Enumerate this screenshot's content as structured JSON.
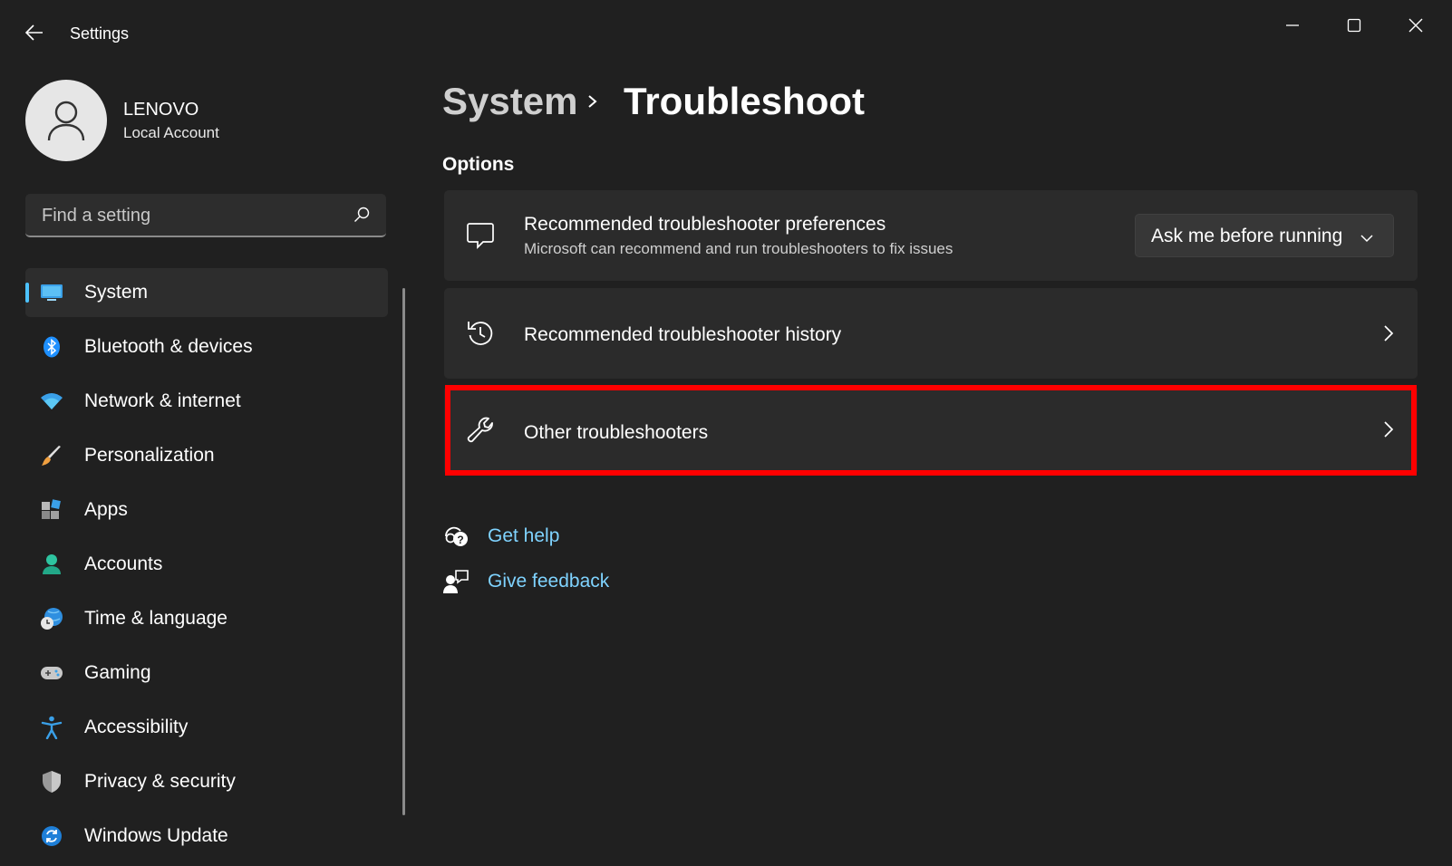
{
  "window": {
    "title": "Settings",
    "controls": {
      "minimize": "minimize-icon",
      "maximize": "maximize-icon",
      "close": "close-icon"
    }
  },
  "user": {
    "name": "LENOVO",
    "account_type": "Local Account"
  },
  "search": {
    "placeholder": "Find a setting",
    "value": ""
  },
  "nav": {
    "items": [
      {
        "label": "System",
        "icon": "monitor-icon",
        "active": true
      },
      {
        "label": "Bluetooth & devices",
        "icon": "bluetooth-icon"
      },
      {
        "label": "Network & internet",
        "icon": "wifi-icon"
      },
      {
        "label": "Personalization",
        "icon": "brush-icon"
      },
      {
        "label": "Apps",
        "icon": "apps-icon"
      },
      {
        "label": "Accounts",
        "icon": "person-icon"
      },
      {
        "label": "Time & language",
        "icon": "globe-clock-icon"
      },
      {
        "label": "Gaming",
        "icon": "gamepad-icon"
      },
      {
        "label": "Accessibility",
        "icon": "accessibility-icon"
      },
      {
        "label": "Privacy & security",
        "icon": "shield-icon"
      },
      {
        "label": "Windows Update",
        "icon": "update-icon"
      }
    ]
  },
  "breadcrumb": {
    "parent": "System",
    "current": "Troubleshoot"
  },
  "section": {
    "title": "Options"
  },
  "cards": {
    "preferences": {
      "title": "Recommended troubleshooter preferences",
      "subtitle": "Microsoft can recommend and run troubleshooters to fix issues",
      "dropdown_value": "Ask me before running"
    },
    "history": {
      "title": "Recommended troubleshooter history"
    },
    "other": {
      "title": "Other troubleshooters",
      "highlighted": true
    }
  },
  "links": {
    "help": "Get help",
    "feedback": "Give feedback"
  },
  "colors": {
    "accent": "#4cc2ff",
    "link": "#7fd3ff",
    "highlight": "#ff0000",
    "background": "#202020",
    "card": "#2b2b2b"
  }
}
